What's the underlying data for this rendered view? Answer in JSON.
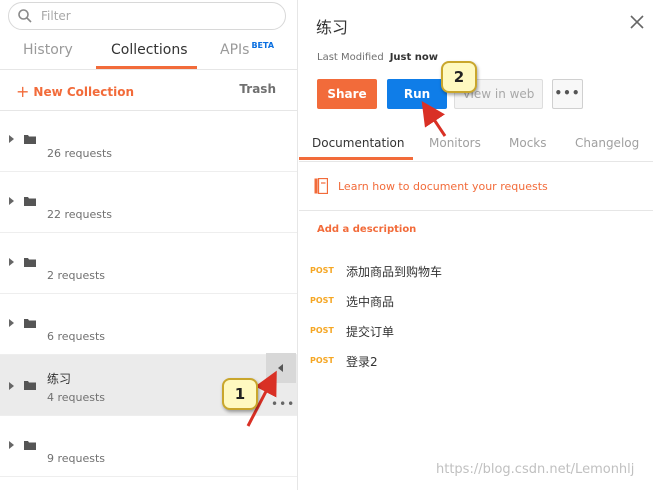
{
  "sidebar": {
    "search_placeholder": "Filter",
    "tabs": [
      {
        "label": "History",
        "badge": ""
      },
      {
        "label": "Collections",
        "badge": ""
      },
      {
        "label": "APIs",
        "badge": "BETA"
      }
    ],
    "active_tab": "Collections",
    "new_collection_label": "New Collection",
    "trash_label": "Trash",
    "collections": [
      {
        "name": "",
        "count": "26 requests"
      },
      {
        "name": "",
        "count": "22 requests"
      },
      {
        "name": "",
        "count": "2 requests"
      },
      {
        "name": "",
        "count": "6 requests"
      },
      {
        "name": "练习",
        "count": "4 requests"
      },
      {
        "name": "",
        "count": "9 requests"
      }
    ],
    "selected_collection": "练习"
  },
  "panel": {
    "title": "练习",
    "last_modified_label": "Last Modified",
    "last_modified_value": "Just now",
    "share_label": "Share",
    "run_label": "Run",
    "view_web_label": "View in web",
    "more_label": "•••",
    "tabs": [
      "Documentation",
      "Monitors",
      "Mocks",
      "Changelog"
    ],
    "active_tab": "Documentation",
    "learn_link": "Learn how to document your requests",
    "add_description": "Add a description",
    "requests": [
      {
        "method": "POST",
        "name": "添加商品到购物车"
      },
      {
        "method": "POST",
        "name": "选中商品"
      },
      {
        "method": "POST",
        "name": "提交订单"
      },
      {
        "method": "POST",
        "name": "登录2"
      }
    ]
  },
  "row_more_label": "•••",
  "annotations": [
    "1",
    "2"
  ],
  "watermark": "https://blog.csdn.net/Lemonhlj",
  "colors": {
    "accent": "#f26b3a",
    "run_blue": "#0f7de8",
    "post_method": "#f5a623",
    "beta": "#0a6fe0",
    "selected_row": "#ebebeb"
  }
}
